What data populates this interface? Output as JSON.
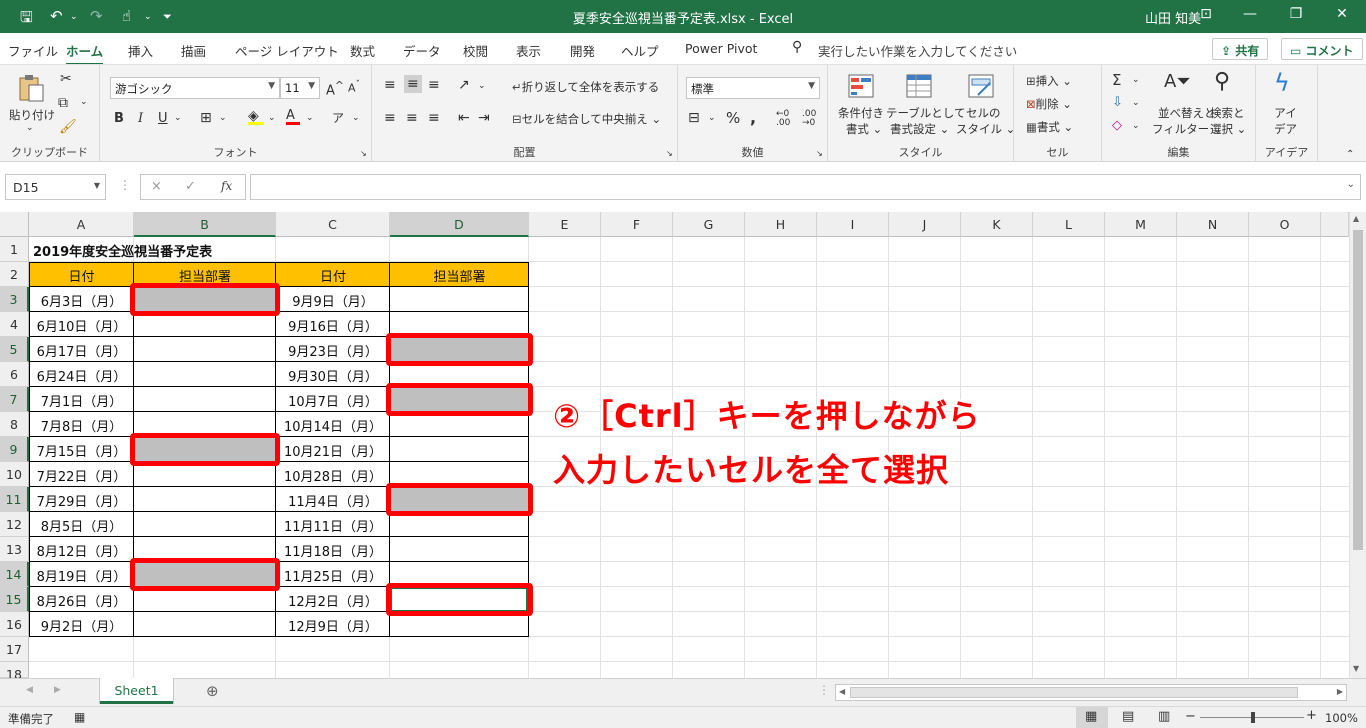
{
  "titlebar": {
    "title": "夏季安全巡視当番予定表.xlsx  -  Excel",
    "user": "山田 知美"
  },
  "menu": {
    "tabs": [
      "ファイル",
      "ホーム",
      "挿入",
      "描画",
      "ページ レイアウト",
      "数式",
      "データ",
      "校閲",
      "表示",
      "開発",
      "ヘルプ",
      "Power Pivot"
    ],
    "search_placeholder": "実行したい作業を入力してください",
    "share_label": "共有",
    "comment_label": "コメント"
  },
  "ribbon": {
    "clipboard": {
      "paste": "貼り付け",
      "group": "クリップボード"
    },
    "font": {
      "name": "游ゴシック",
      "size": "11",
      "group": "フォント"
    },
    "alignment": {
      "wrap": "折り返して全体を表示する",
      "merge": "セルを結合して中央揃え",
      "group": "配置"
    },
    "number": {
      "format": "標準",
      "group": "数値"
    },
    "styles": {
      "conditional": "条件付き",
      "conditional2": "書式",
      "table": "テーブルとして",
      "table2": "書式設定",
      "cellstyle": "セルの",
      "cellstyle2": "スタイル",
      "group": "スタイル"
    },
    "cells": {
      "insert": "挿入",
      "delete": "削除",
      "format": "書式",
      "group": "セル"
    },
    "editing": {
      "sort": "並べ替えと",
      "sort2": "フィルター",
      "find": "検索と",
      "find2": "選択",
      "group": "編集"
    },
    "ideas": {
      "label": "アイ",
      "label2": "デア",
      "group": "アイデア"
    }
  },
  "formula_bar": {
    "name_box": "D15",
    "cancel": "×",
    "enter": "✓",
    "fx": "fx",
    "content": ""
  },
  "sheet": {
    "columns": [
      "A",
      "B",
      "C",
      "D",
      "E",
      "F",
      "G",
      "H",
      "I",
      "J",
      "K",
      "L",
      "M",
      "N",
      "O"
    ],
    "rows": [
      "1",
      "2",
      "3",
      "4",
      "5",
      "6",
      "7",
      "8",
      "9",
      "10",
      "11",
      "12",
      "13",
      "14",
      "15",
      "16",
      "17",
      "18"
    ],
    "title": "2019年度安全巡視当番予定表",
    "headers": [
      "日付",
      "担当部署",
      "日付",
      "担当部署"
    ],
    "col_a": [
      "6月3日（月）",
      "6月10日（月）",
      "6月17日（月）",
      "6月24日（月）",
      "7月1日（月）",
      "7月8日（月）",
      "7月15日（月）",
      "7月22日（月）",
      "7月29日（月）",
      "8月5日（月）",
      "8月12日（月）",
      "8月19日（月）",
      "8月26日（月）",
      "9月2日（月）"
    ],
    "col_c": [
      "9月9日（月）",
      "9月16日（月）",
      "9月23日（月）",
      "9月30日（月）",
      "10月7日（月）",
      "10月14日（月）",
      "10月21日（月）",
      "10月28日（月）",
      "11月4日（月）",
      "11月11日（月）",
      "11月18日（月）",
      "11月25日（月）",
      "12月2日（月）",
      "12月9日（月）"
    ]
  },
  "annotation": {
    "line1": "②［Ctrl］キーを押しながら",
    "line2": "入力したいセルを全て選択",
    "color": "#ff0000"
  },
  "sheet_tabs": {
    "active": "Sheet1"
  },
  "status": {
    "ready": "準備完了",
    "zoom": "100%"
  },
  "colors": {
    "excel_green": "#217346",
    "header_fill": "#ffc000",
    "selected_fill": "#bfbfbf"
  }
}
